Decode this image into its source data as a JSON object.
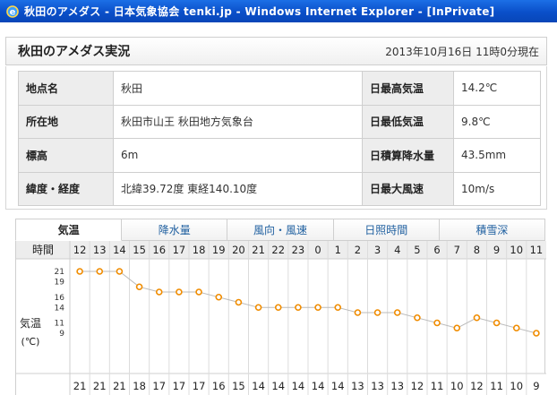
{
  "window": {
    "title": "秋田のアメダス - 日本気象協会 tenki.jp - Windows Internet Explorer - [InPrivate]"
  },
  "header": {
    "title": "秋田のアメダス実況",
    "datetime": "2013年10月16日 11時0分現在"
  },
  "info": {
    "rows": [
      {
        "label": "地点名",
        "value": "秋田",
        "label2": "日最高気温",
        "value2": "14.2℃"
      },
      {
        "label": "所在地",
        "value": "秋田市山王 秋田地方気象台",
        "label2": "日最低気温",
        "value2": "9.8℃"
      },
      {
        "label": "標高",
        "value": "6m",
        "label2": "日積算降水量",
        "value2": "43.5mm"
      },
      {
        "label": "緯度・経度",
        "value": "北緯39.72度 東経140.10度",
        "label2": "日最大風速",
        "value2": "10m/s"
      }
    ]
  },
  "tabs": [
    "気温",
    "降水量",
    "風向・風速",
    "日照時間",
    "積雪深"
  ],
  "chart": {
    "hour_label": "時間",
    "ylabel": "気温",
    "unit": "(℃)",
    "colors": {
      "marker": "#f08c00",
      "line": "#bbbbbb",
      "grid": "#dcdcdc",
      "header_bg": "#ededed"
    }
  },
  "chart_data": {
    "type": "line",
    "x": [
      "12",
      "13",
      "14",
      "15",
      "16",
      "17",
      "18",
      "19",
      "20",
      "21",
      "22",
      "23",
      "0",
      "1",
      "2",
      "3",
      "4",
      "5",
      "6",
      "7",
      "8",
      "9",
      "10",
      "11"
    ],
    "yticks": [
      "21",
      "19",
      "16",
      "14",
      "11",
      "9"
    ],
    "ylim": [
      8.5,
      21
    ],
    "series": [
      {
        "values": [
          21,
          21,
          21,
          18,
          17,
          17,
          17,
          16,
          15,
          14,
          14,
          14,
          14,
          14,
          13,
          13,
          13,
          12,
          11,
          10,
          12,
          11,
          10,
          9
        ]
      }
    ]
  }
}
